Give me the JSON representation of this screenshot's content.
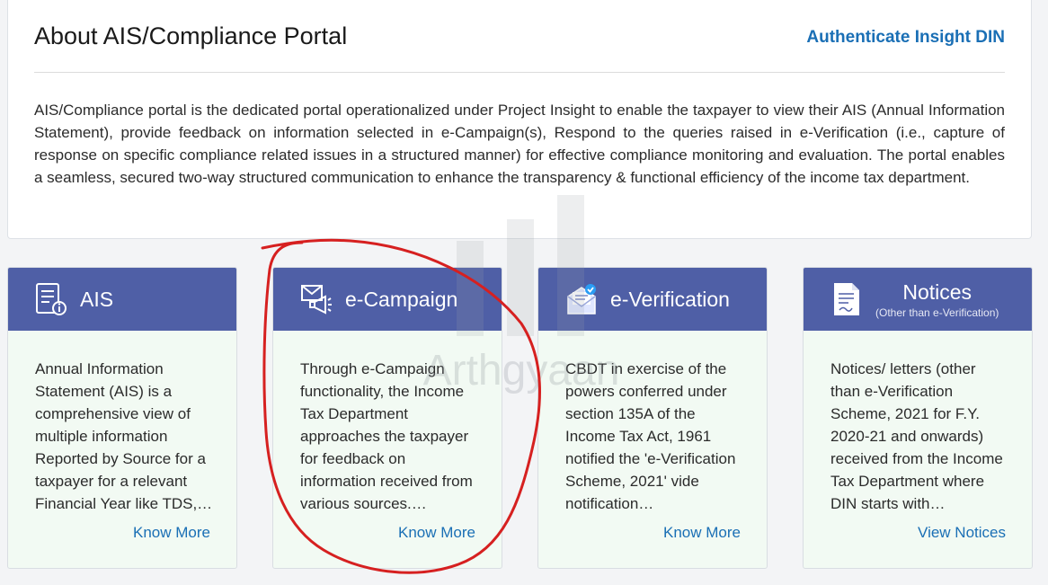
{
  "about": {
    "title": "About AIS/Compliance Portal",
    "link_label": "Authenticate Insight DIN",
    "description": "AIS/Compliance portal is the dedicated portal operationalized under Project Insight to enable the taxpayer to view their AIS (Annual Information Statement), provide feedback on information selected in e-Campaign(s), Respond to the queries raised in e-Verification (i.e., capture of response on specific compliance related issues in a structured manner) for effective compliance monitoring and evaluation. The portal enables a seamless, secured two-way structured communication to enhance the transparency & functional efficiency of the income tax department."
  },
  "cards": [
    {
      "title": "AIS",
      "icon": "document-info-icon",
      "body": "Annual Information Statement (AIS) is a comprehensive view of multiple information Reported by Source for a taxpayer for a relevant Financial Year like TDS,…",
      "link_label": "Know More"
    },
    {
      "title": "e-Campaign",
      "icon": "megaphone-mail-icon",
      "body": "Through e-Campaign functionality, the Income Tax Department approaches the taxpayer for feedback on information received from various sources.…",
      "link_label": "Know More"
    },
    {
      "title": "e-Verification",
      "icon": "verified-mail-icon",
      "body": "CBDT in exercise of the powers conferred under section 135A of the Income Tax Act, 1961 notified the 'e-Verification Scheme, 2021' vide notification…",
      "link_label": "Know More"
    },
    {
      "title": "Notices",
      "subtitle": "(Other than e-Verification)",
      "icon": "notice-document-icon",
      "body": "Notices/ letters (other than e-Verification Scheme, 2021 for F.Y. 2020-21 and onwards) received from the Income Tax Department where DIN starts with…",
      "link_label": "View Notices"
    }
  ],
  "watermark": {
    "text": "Arthgyaan"
  },
  "colors": {
    "card_header": "#4f5fa6",
    "card_body": "#f2faf3",
    "link": "#1a6fb5",
    "annotation": "#d62020"
  }
}
